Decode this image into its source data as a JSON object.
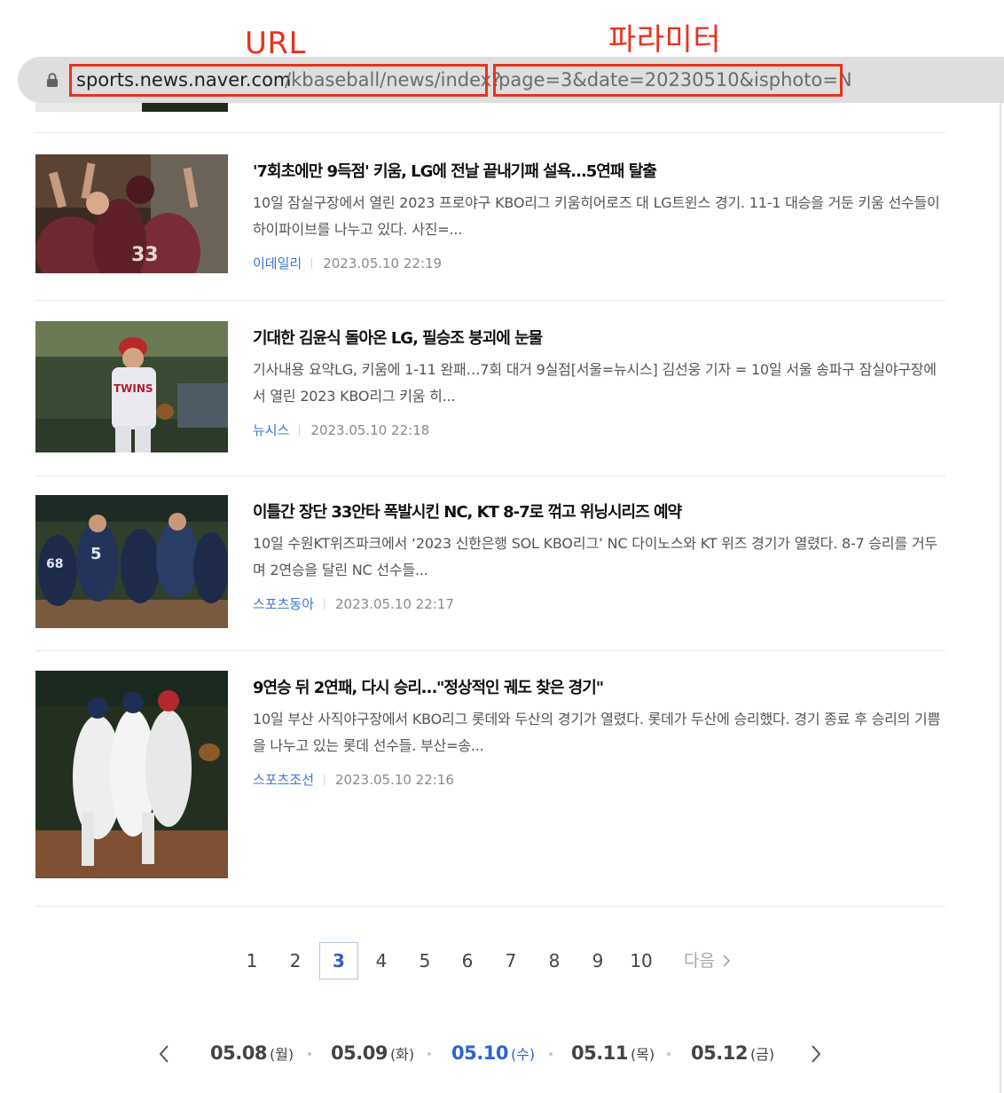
{
  "annotations": {
    "url_label": "URL",
    "param_label": "파라미터"
  },
  "address_bar": {
    "host": "sports.news.naver.com",
    "path": "/kbaseball/news/index?",
    "query": "page=3&date=20230510&isphoto=N"
  },
  "articles": [
    {
      "title": "'7회초에만 9득점' 키움, LG에 전날 끝내기패 설욕...5연패 탈출",
      "summary": "10일 잠실구장에서 열린 2023 프로야구 KBO리그 키움히어로즈 대 LG트윈스 경기. 11-1 대승을 거둔 키움 선수들이 하이파이브를 나누고 있다. 사진=...",
      "press": "이데일리",
      "time": "2023.05.10 22:19"
    },
    {
      "title": "기대한 김윤식 돌아온 LG, 필승조 붕괴에 눈물",
      "summary": "기사내용 요약LG, 키움에 1-11 완패…7회 대거 9실점[서울=뉴시스] 김선웅 기자 = 10일 서울 송파구 잠실야구장에서 열린 2023 KBO리그 키움 히...",
      "press": "뉴시스",
      "time": "2023.05.10 22:18"
    },
    {
      "title": "이틀간 장단 33안타 폭발시킨 NC, KT 8-7로 꺾고 위닝시리즈 예약",
      "summary": "10일 수원KT위즈파크에서 ‘2023 신한은행 SOL KBO리그’ NC 다이노스와 KT 위즈 경기가 열렸다. 8-7 승리를 거두며 2연승을 달린 NC 선수들...",
      "press": "스포츠동아",
      "time": "2023.05.10 22:17"
    },
    {
      "title": "9연승 뒤 2연패, 다시 승리…\"정상적인 궤도 찾은 경기\"",
      "summary": "10일 부산 사직야구장에서 KBO리그 롯데와 두산의 경기가 열렸다. 롯데가 두산에 승리했다. 경기 종료 후 승리의 기쁨을 나누고 있는 롯데 선수들. 부산=송...",
      "press": "스포츠조선",
      "time": "2023.05.10 22:16"
    }
  ],
  "pagination": {
    "pages": [
      "1",
      "2",
      "3",
      "4",
      "5",
      "6",
      "7",
      "8",
      "9",
      "10"
    ],
    "current": "3",
    "next_label": "다음"
  },
  "dates": [
    {
      "date": "05.08",
      "weekday": "(월)"
    },
    {
      "date": "05.09",
      "weekday": "(화)"
    },
    {
      "date": "05.10",
      "weekday": "(수)"
    },
    {
      "date": "05.11",
      "weekday": "(목)"
    },
    {
      "date": "05.12",
      "weekday": "(금)"
    }
  ],
  "selected_date": "05.10",
  "colors": {
    "annotation": "#e8321e",
    "press_link": "#3e75d6",
    "active": "#2d63d3"
  }
}
